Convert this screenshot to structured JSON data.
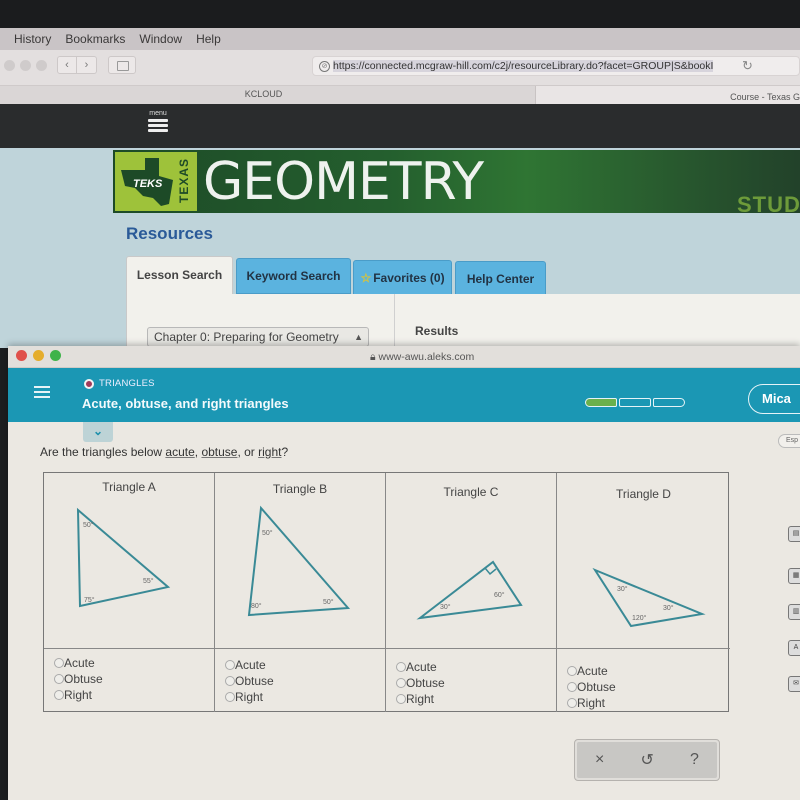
{
  "mac_menu": [
    "History",
    "Bookmarks",
    "Window",
    "Help"
  ],
  "browser": {
    "url": "https://connected.mcgraw-hill.com/c2j/resourceLibrary.do?facet=GROUP|S&bookI",
    "tabs": [
      {
        "label": "KCLOUD"
      },
      {
        "label": "Course - Texas G"
      }
    ]
  },
  "mcgraw": {
    "menu_label": "menu",
    "logo_teks": "TEKS",
    "logo_texas": "TEXAS",
    "banner_title": "GEOMETRY",
    "banner_right": "STUD",
    "section_title": "Resources",
    "tabs": [
      {
        "label": "Lesson Search",
        "active": true
      },
      {
        "label": "Keyword Search",
        "active": false
      },
      {
        "label": "Favorites (0)",
        "active": false
      },
      {
        "label": "Help Center",
        "active": false
      }
    ],
    "chapter_select": "Chapter 0: Preparing for Geometry",
    "results_label": "Results"
  },
  "aleks": {
    "window_url": "www-awu.aleks.com",
    "topic_category": "TRIANGLES",
    "topic_title": "Acute, obtuse, and right triangles",
    "progress": {
      "filled": 1,
      "total": 3
    },
    "user_name": "Mica",
    "lang_button": "Esp",
    "question_prefix": "Are the triangles below ",
    "question_links": [
      "acute",
      "obtuse",
      "right"
    ],
    "question_sep1": ", ",
    "question_sep2": ", or ",
    "question_suffix": "?",
    "triangles": [
      {
        "title": "Triangle A",
        "angles": [
          "50°",
          "55°",
          "75°"
        ],
        "right_angle_marker": false
      },
      {
        "title": "Triangle B",
        "angles": [
          "50°",
          "50°",
          "80°"
        ],
        "right_angle_marker": false
      },
      {
        "title": "Triangle C",
        "angles": [
          "30°",
          "60°"
        ],
        "right_angle_marker": true
      },
      {
        "title": "Triangle D",
        "angles": [
          "30°",
          "30°",
          "120°"
        ],
        "right_angle_marker": false
      }
    ],
    "choices": [
      "Acute",
      "Obtuse",
      "Right"
    ],
    "actions": {
      "clear": "×",
      "undo": "↺",
      "help": "?"
    }
  },
  "colors": {
    "aleks_header": "#1b97b4",
    "banner_green": "#245f2e",
    "teks_lime": "#9ec23a",
    "tab_blue": "#5bb3df",
    "progress_fill": "#6ab04c",
    "triangle_stroke": "#3a8a96"
  }
}
